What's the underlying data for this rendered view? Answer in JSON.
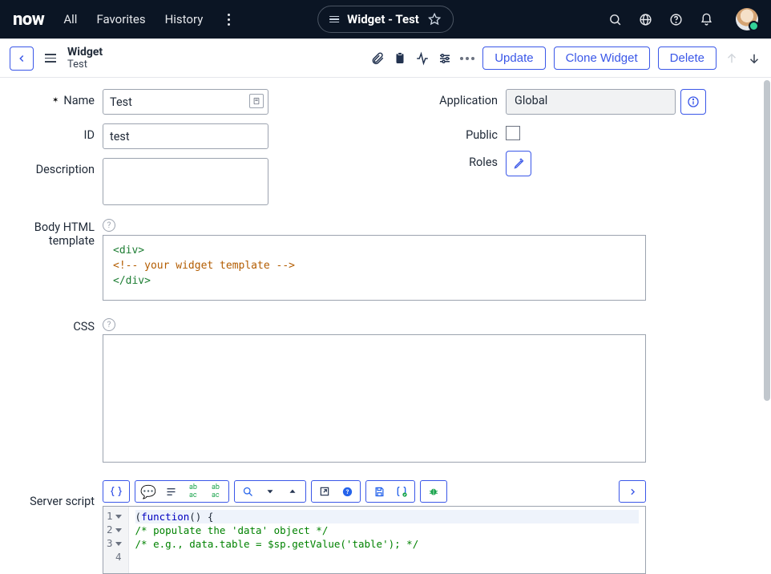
{
  "nav": {
    "logo": "now",
    "links": [
      "All",
      "Favorites",
      "History"
    ],
    "pill_title": "Widget - Test"
  },
  "header": {
    "title": "Widget",
    "subtitle": "Test",
    "buttons": {
      "update": "Update",
      "clone": "Clone Widget",
      "delete": "Delete"
    }
  },
  "form": {
    "name_label": "Name",
    "name_value": "Test",
    "id_label": "ID",
    "id_value": "test",
    "description_label": "Description",
    "description_value": "",
    "application_label": "Application",
    "application_value": "Global",
    "public_label": "Public",
    "public_checked": false,
    "roles_label": "Roles",
    "body_html_label": "Body HTML template",
    "body_html_lines": {
      "l1_open": "<div>",
      "l2_cmt": "<!-- your widget template -->",
      "l3_close": "</div>"
    },
    "css_label": "CSS",
    "server_label": "Server script"
  },
  "server_script": {
    "lines": {
      "n1": "1",
      "n2": "2",
      "n3": "3",
      "n4": "4",
      "l1a": "(",
      "l1b": "function",
      "l1c": "() {",
      "l2": "  /* populate the 'data' object */",
      "l3": "  /* e.g., data.table = $sp.getValue('table'); */",
      "l4": ""
    }
  }
}
